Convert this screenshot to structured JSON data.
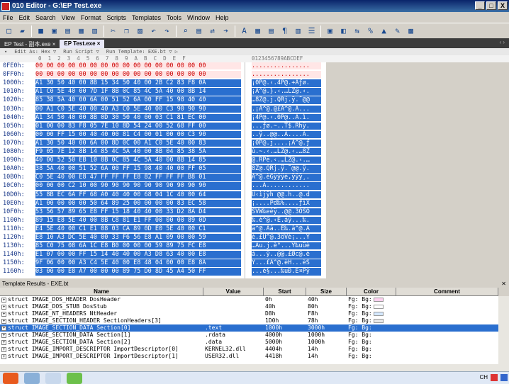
{
  "title": "010 Editor - G:\\EP Test.exe",
  "window_buttons": [
    "_",
    "□",
    "X"
  ],
  "menu": [
    "File",
    "Edit",
    "Search",
    "View",
    "Format",
    "Scripts",
    "Templates",
    "Tools",
    "Window",
    "Help"
  ],
  "tabs": [
    {
      "label": "EP Test - 副本.exe ×"
    },
    {
      "label": "EP Test.exe ×"
    }
  ],
  "hex_header": {
    "edit_as": "Edit As: Hex ▽",
    "run_script": "Run Script ▽",
    "run_template": "Run Template: EXE.bt ▽ ▷"
  },
  "col_header": "  0  1  2  3  4  5  6  7  8  9  A  B  C  D  E  F",
  "col_header_ascii": "0123456789ABCDEF",
  "rows": [
    {
      "addr": "0FE0h:",
      "hex": "00 00 00 00 00 00 00 00 00 00 00 00 00 00 00 00",
      "ascii": "................",
      "zero": true
    },
    {
      "addr": "0FF0h:",
      "hex": "00 00 00 00 00 00 00 00 00 00 00 00 00 00 00 00",
      "ascii": "................",
      "zero": true
    },
    {
      "addr": "1000h:",
      "hex": "A1 30 50 40 00 8B 15 34 50 40 00 2B C2 83 F8 0A",
      "ascii": "¡0P@.‹.4P@.+Âƒø.",
      "sel": true
    },
    {
      "addr": "1010h:",
      "hex": "A1 C0 5E 40 00 7D 1F 8B 0C 85 4C 5A 40 00 8B 14",
      "ascii": "¡À^@.}.‹.…LZ@.‹.",
      "sel": true
    },
    {
      "addr": "1020h:",
      "hex": "85 38 5A 40 00 6A 00 51 52 6A 00 FF 15 98 40 40",
      "ascii": "…8Z@.j.QRj.ÿ.˜@@",
      "sel": true
    },
    {
      "addr": "1030h:",
      "hex": "00 A1 C0 5E 40 00 40 A3 C0 5E 40 00 C3 90 90 90",
      "ascii": ".¡À^@.@£À^@.Ã...",
      "sel": true
    },
    {
      "addr": "1040h:",
      "hex": "A1 34 50 40 00 8B 0D 30 50 40 00 03 C1 81 EC 00",
      "ascii": "¡4P@.‹.0P@..Á.ì.",
      "sel": true
    },
    {
      "addr": "1050h:",
      "hex": "01 00 00 83 F8 05 7E 10 8D 54 24 00 52 68 FF 00",
      "ascii": "...ƒø.~..T$.Rhÿ.",
      "sel": true
    },
    {
      "addr": "1060h:",
      "hex": "00 00 FF 15 00 40 40 00 81 C4 00 01 00 00 C3 90",
      "ascii": "..ÿ..@@..Ä....Ã.",
      "sel": true
    },
    {
      "addr": "1070h:",
      "hex": "A1 30 50 40 00 6A 00 8D 0C 00 A1 C0 5E 40 00 83",
      "ascii": "¡0P@.j....¡À^@.ƒ",
      "sel": true
    },
    {
      "addr": "1080h:",
      "hex": "F9 05 7E 12 8B 14 85 4C 5A 40 00 8B 04 85 38 5A",
      "ascii": "ù.~.‹.…LZ@.‹.…8Z",
      "sel": true
    },
    {
      "addr": "1090h:",
      "hex": "40 00 52 50 EB 10 8B 0C 85 4C 5A 40 00 8B 14 85",
      "ascii": "@.RPë.‹.…LZ@.‹.…",
      "sel": true
    },
    {
      "addr": "10A0h:",
      "hex": "38 5A 40 00 51 52 6A 00 FF 15 98 40 40 00 FF 05",
      "ascii": "8Z@.QRj.ÿ.˜@@.ÿ.",
      "sel": true
    },
    {
      "addr": "10B0h:",
      "hex": "C0 5E 40 00 E8 47 FF FF FF E8 82 FF FF FF B8 01",
      "ascii": "À^@.èGÿÿÿè‚ÿÿÿ¸.",
      "sel": true
    },
    {
      "addr": "10C0h:",
      "hex": "00 00 00 C2 10 00 90 90 90 90 90 90 90 90 90 90",
      "ascii": "...Â............",
      "sel": true
    },
    {
      "addr": "10D0h:",
      "hex": "55 8B EC 6A FF 68 A0 40 40 00 68 04 1C 40 00 64",
      "ascii": "U‹ìjÿh @@.h..@.d",
      "sel": true
    },
    {
      "addr": "10E0h:",
      "hex": "A1 00 00 00 00 50 64 89 25 00 00 00 00 83 EC 58",
      "ascii": "¡....Pd‰%....ƒìX",
      "sel": true
    },
    {
      "addr": "10F0h:",
      "hex": "53 56 57 89 65 E8 FF 15 18 40 40 00 33 D2 8A D4",
      "ascii": "SVW‰eèÿ..@@.3ÒŠÔ",
      "sel": true
    },
    {
      "addr": "1100h:",
      "hex": "89 15 E8 5E 40 00 8B C8 81 E1 FF 00 00 00 89 0D",
      "ascii": "‰.è^@.‹È.áÿ...‰.",
      "sel": true
    },
    {
      "addr": "1110h:",
      "hex": "E4 5E 40 00 C1 E1 08 03 CA 89 0D E0 5E 40 00 C1",
      "ascii": "ä^@.Áá..Ê‰.à^@.Á",
      "sel": true
    },
    {
      "addr": "1120h:",
      "hex": "E8 10 A3 DC 5E 40 00 33 F6 56 E8 A1 09 00 00 59",
      "ascii": "è.£Ü^@.3öVè¡...Y",
      "sel": true
    },
    {
      "addr": "1130h:",
      "hex": "85 C0 75 08 6A 1C E8 B0 00 00 00 59 89 75 FC E8",
      "ascii": "…Àu.j.è°...Y‰uüè",
      "sel": true
    },
    {
      "addr": "1140h:",
      "hex": "E1 07 00 00 FF 15 14 40 40 00 A3 D8 63 40 00 E8",
      "ascii": "á...ÿ..@@.£Øc@.è",
      "sel": true
    },
    {
      "addr": "1150h:",
      "hex": "9F 06 00 00 A3 C4 5E 40 00 E8 48 04 00 00 E8 8A",
      "ascii": "Ÿ...£Ä^@.èH...èŠ",
      "sel": true
    },
    {
      "addr": "1160h:",
      "hex": "03 00 00 E8 A7 00 00 00 89 75 D0 8D 45 A4 50 FF",
      "ascii": "...è§...‰uÐ.E¤Pÿ",
      "sel": true
    }
  ],
  "template_results_title": "Template Results - EXE.bt",
  "template_columns": [
    "Name",
    "Value",
    "Start",
    "Size",
    "Color",
    "Comment"
  ],
  "template_rows": [
    {
      "name": "struct IMAGE_DOS_HEADER DosHeader",
      "value": "",
      "start": "0h",
      "size": "40h",
      "fg": "Fg:",
      "bg": "Bg:",
      "bgcolor": "#ffd0f0"
    },
    {
      "name": "struct IMAGE_DOS_STUB DosStub",
      "value": "",
      "start": "40h",
      "size": "80h",
      "fg": "Fg:",
      "bg": "Bg:",
      "bgcolor": "#ffffff"
    },
    {
      "name": "struct IMAGE_NT_HEADERS NtHeader",
      "value": "",
      "start": "D8h",
      "size": "F8h",
      "fg": "Fg:",
      "bg": "Bg:",
      "bgcolor": "#d4e8ff"
    },
    {
      "name": "struct IMAGE_SECTION_HEADER SectionHeaders[3]",
      "value": "",
      "start": "1D0h",
      "size": "78h",
      "fg": "Fg:",
      "bg": "Bg:",
      "bgcolor": "#e8e8e8"
    },
    {
      "name": "struct IMAGE_SECTION_DATA Section[0]",
      "value": ".text",
      "start": "1000h",
      "size": "3000h",
      "fg": "Fg:",
      "bg": "Bg:",
      "bgcolor": "",
      "sel": true
    },
    {
      "name": "struct IMAGE_SECTION_DATA Section[1]",
      "value": ".rdata",
      "start": "4000h",
      "size": "1000h",
      "fg": "Fg:",
      "bg": "Bg:",
      "bgcolor": ""
    },
    {
      "name": "struct IMAGE_SECTION_DATA Section[2]",
      "value": ".data",
      "start": "5000h",
      "size": "1000h",
      "fg": "Fg:",
      "bg": "Bg:",
      "bgcolor": ""
    },
    {
      "name": "struct IMAGE_IMPORT_DESCRIPTOR ImportDescriptor[0]",
      "value": "KERNEL32.dll",
      "start": "4404h",
      "size": "14h",
      "fg": "Fg:",
      "bg": "Bg:",
      "bgcolor": ""
    },
    {
      "name": "struct IMAGE_IMPORT_DESCRIPTOR ImportDescriptor[1]",
      "value": "USER32.dll",
      "start": "4418h",
      "size": "14h",
      "fg": "Fg:",
      "bg": "Bg:",
      "bgcolor": ""
    }
  ],
  "tray": {
    "lang": "CH"
  }
}
